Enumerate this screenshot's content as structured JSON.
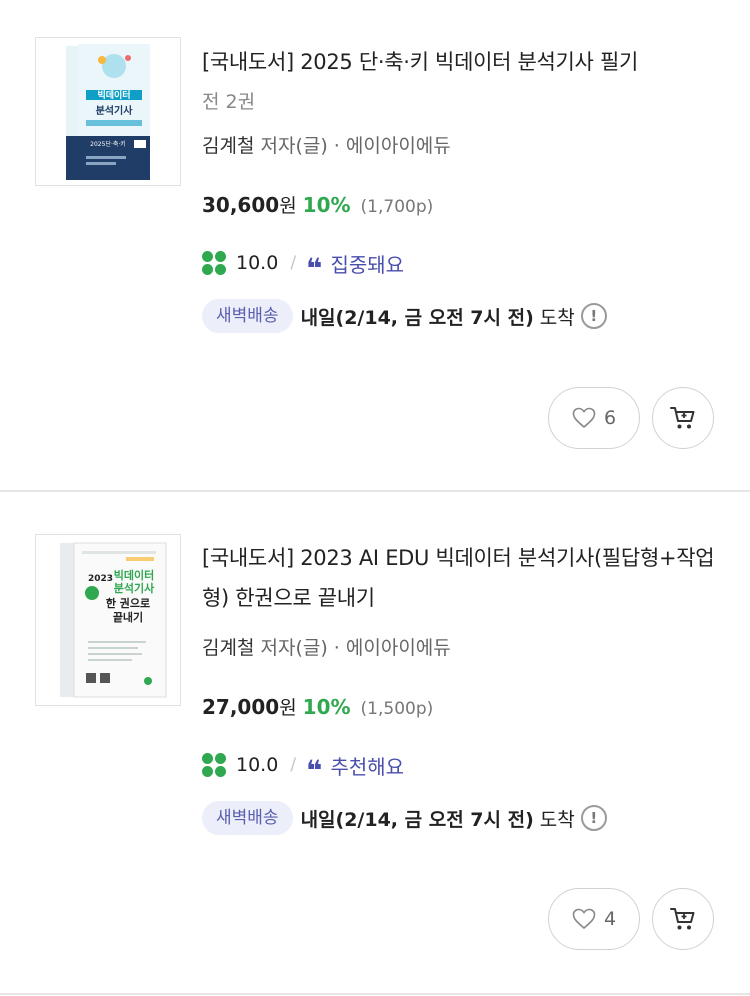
{
  "products": [
    {
      "title": "[국내도서] 2025 단·축·키 빅데이터 분석기사 필기",
      "sub": "전 2권",
      "author_name": "김계철",
      "author_role": " 저자(글) · 에이아이에듀",
      "price": "30,600",
      "won": "원",
      "discount": "10%",
      "points": "(1,700p)",
      "rating": "10.0",
      "slash": "/",
      "quote": "❝",
      "review": "집중돼요",
      "badge": "새벽배송",
      "delivery": "내일(2/14, 금 오전 7시 전)",
      "arrive": "도착",
      "info": "!",
      "likes": "6",
      "cover": {
        "small_text": "빅데이터",
        "big_text": "분석기사",
        "year_text": "2025단·축·키",
        "accent": "#0f9fc6",
        "bg": "#1f3d66"
      }
    },
    {
      "title": "[국내도서] 2023 AI EDU 빅데이터 분석기사(필답형+작업형) 한권으로 끝내기",
      "author_name": "김계철",
      "author_role": " 저자(글) · 에이아이에듀",
      "price": "27,000",
      "won": "원",
      "discount": "10%",
      "points": "(1,500p)",
      "rating": "10.0",
      "slash": "/",
      "quote": "❝",
      "review": "추천해요",
      "badge": "새벽배송",
      "delivery": "내일(2/14, 금 오전 7시 전)",
      "arrive": "도착",
      "info": "!",
      "likes": "4",
      "cover": {
        "year_text": "2023",
        "green_text": "빅데이터",
        "green_text2": "분석기사",
        "black_text": "한 권으로",
        "black_text2": "끝내기",
        "accent": "#2fa84f"
      }
    }
  ],
  "colors": {
    "green": "#2fa84f",
    "indigo": "#4a4fae",
    "badge_bg": "#eceef9"
  }
}
